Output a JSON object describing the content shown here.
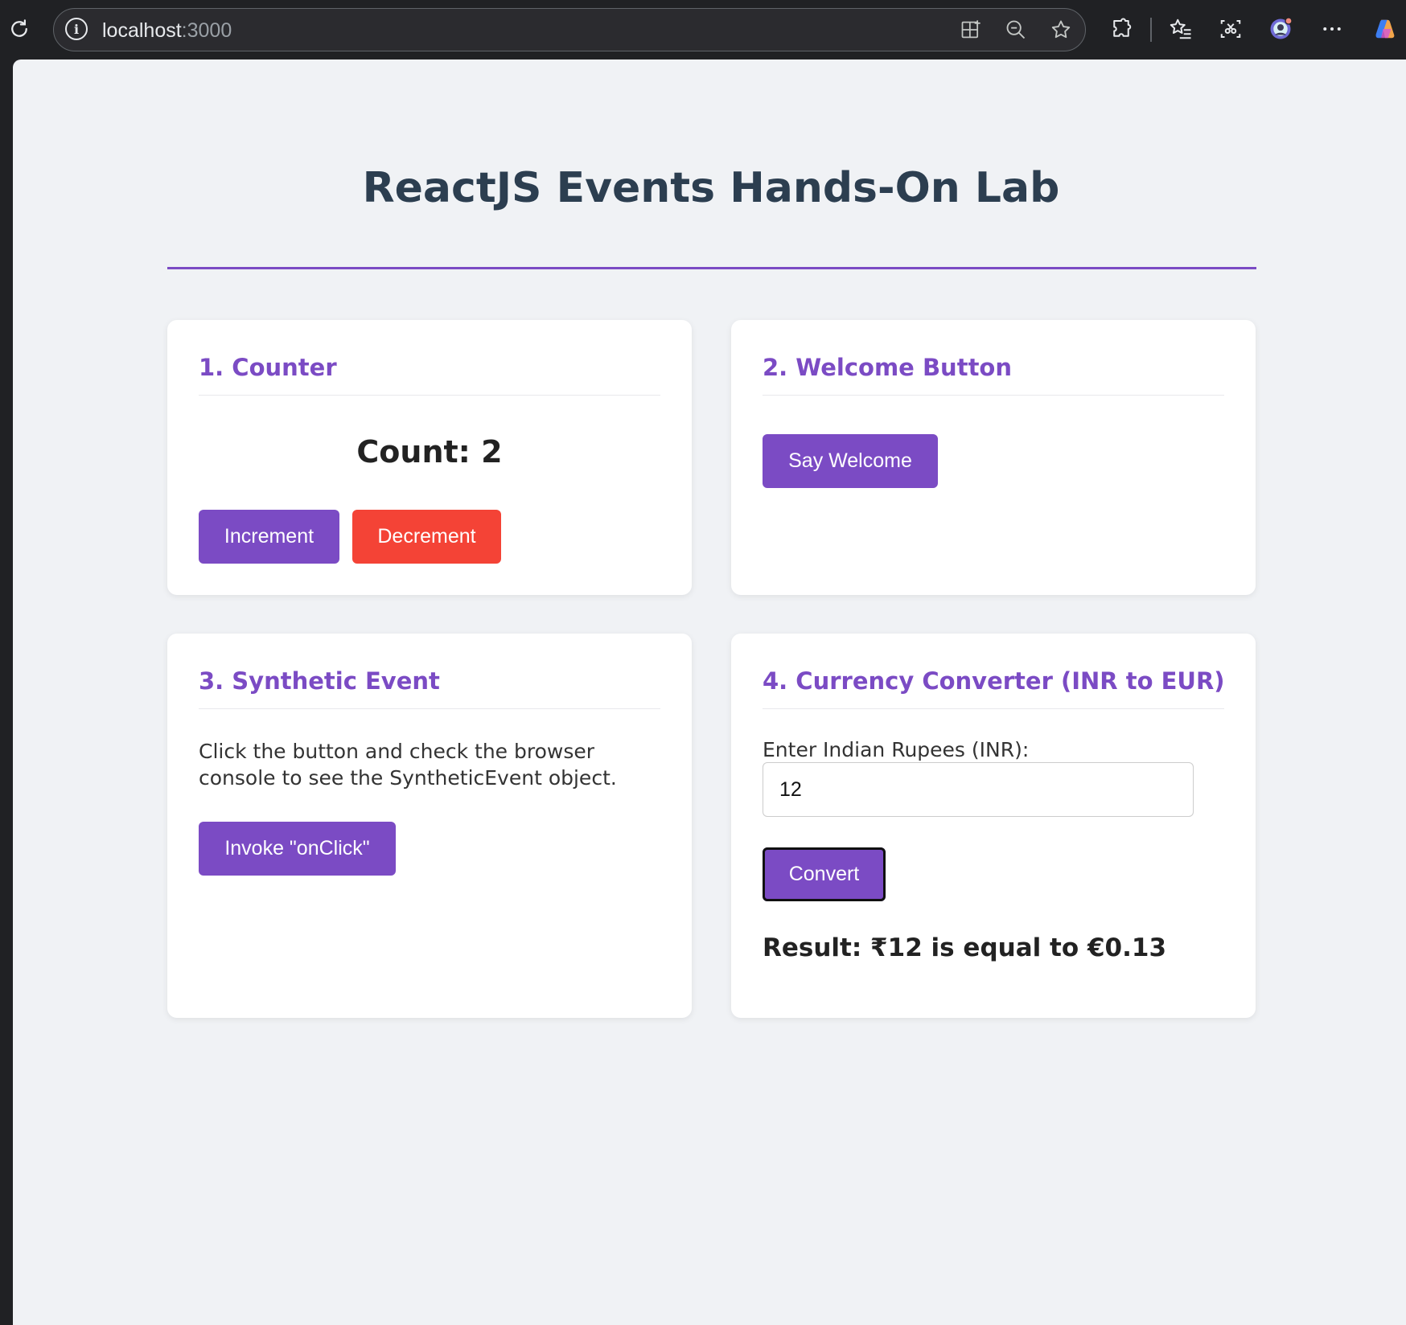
{
  "browser": {
    "url_host": "localhost",
    "url_port": ":3000"
  },
  "page": {
    "title": "ReactJS Events Hands-On Lab"
  },
  "counter": {
    "heading": "1. Counter",
    "count_text": "Count: 2",
    "increment_label": "Increment",
    "decrement_label": "Decrement"
  },
  "welcome": {
    "heading": "2. Welcome Button",
    "button_label": "Say Welcome"
  },
  "synthetic": {
    "heading": "3. Synthetic Event",
    "description": "Click the button and check the browser console to see the SyntheticEvent object.",
    "button_label": "Invoke \"onClick\""
  },
  "currency": {
    "heading": "4. Currency Converter (INR to EUR)",
    "input_label": "Enter Indian Rupees (INR):",
    "input_value": "12",
    "button_label": "Convert",
    "result_text": "Result: ₹12 is equal to €0.13"
  },
  "colors": {
    "accent": "#7b4bc4",
    "danger": "#f44336",
    "title": "#2c3e50",
    "background": "#f0f2f5"
  },
  "icons": [
    "reload-icon",
    "info-icon",
    "split-screen-icon",
    "zoom-out-icon",
    "favorite-star-icon",
    "extensions-icon",
    "favorites-list-icon",
    "screenshot-icon",
    "profile-avatar",
    "more-menu-icon",
    "copilot-icon"
  ]
}
